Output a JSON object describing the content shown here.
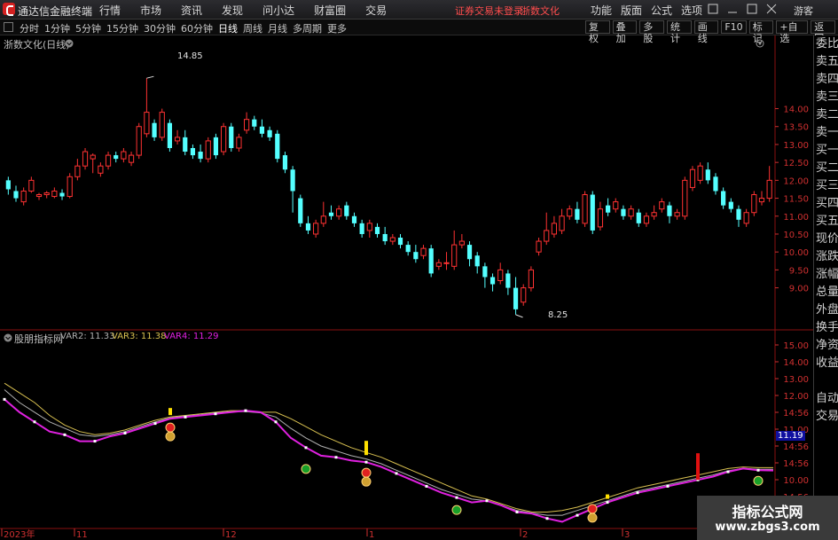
{
  "menubar": {
    "app_name": "通达信金融终端",
    "items": [
      "行情",
      "市场",
      "资讯",
      "发现",
      "问小达",
      "财富圈",
      "交易"
    ],
    "login_status": "证券交易未登录",
    "stock_name": "浙数文化",
    "right_items": [
      "功能",
      "版面",
      "公式",
      "选项"
    ],
    "guest": "游客"
  },
  "toolbar": {
    "periods": [
      "分时",
      "1分钟",
      "5分钟",
      "15分钟",
      "30分钟",
      "60分钟",
      "日线",
      "周线",
      "月线",
      "多周期",
      "更多"
    ],
    "active_period": "日线",
    "tools": [
      "复权",
      "叠加",
      "多股",
      "统计",
      "画线",
      "F10",
      "标记",
      "+自选",
      "返回"
    ]
  },
  "main_chart": {
    "title": "浙数文化(日线)",
    "high_label": "14.85",
    "low_label": "8.25",
    "price_ticks": [
      "14.00",
      "13.50",
      "13.00",
      "12.50",
      "12.00",
      "11.50",
      "11.00",
      "10.50",
      "10.00",
      "9.50",
      "9.00"
    ]
  },
  "indicator": {
    "title": "股朋指标网",
    "var2_label": "VAR2: 11.33",
    "var3_label": "VAR3: 11.38",
    "var4_label": "VAR4: 11.29",
    "current_value": "11.19",
    "ticks": [
      "15.00",
      "14.50",
      "13.00",
      "12.00",
      "11.50",
      "11.00",
      "10.50",
      "10.00"
    ],
    "right_ticks": [
      "15.00",
      "14.00",
      "13.00",
      "12.00",
      "14:56",
      "11.00",
      "14:56",
      "14:56",
      "10.00",
      "14:56"
    ]
  },
  "date_axis": {
    "labels": [
      "2023年",
      "11",
      "12",
      "1",
      "2",
      "3"
    ]
  },
  "right_panel": {
    "items": [
      "委比",
      "卖五",
      "卖四",
      "卖三",
      "卖二",
      "卖一",
      "买一",
      "买二",
      "买三",
      "买四",
      "买五",
      "现价",
      "涨跌",
      "涨幅",
      "总量",
      "外盘",
      "换手",
      "净资",
      "收益",
      "",
      "自动",
      "交易"
    ]
  },
  "watermark": {
    "line1": "指标公式网",
    "line2": "www.zbgs3.com"
  },
  "colors": {
    "up": "#ff3232",
    "down": "#54ffff",
    "var4": "#e020e0",
    "var3": "#d8c050",
    "var2": "#b0b0b0",
    "axis": "#d03030"
  },
  "chart_data": {
    "type": "candlestick",
    "y_range": [
      8.0,
      15.3
    ],
    "candles": [
      [
        12.0,
        11.75,
        12.1,
        11.6
      ],
      [
        11.7,
        11.5,
        11.85,
        11.4
      ],
      [
        11.4,
        11.7,
        11.8,
        11.3
      ],
      [
        11.7,
        12.0,
        12.1,
        11.65
      ],
      [
        11.55,
        11.6,
        11.65,
        11.45
      ],
      [
        11.6,
        11.65,
        11.7,
        11.5
      ],
      [
        11.55,
        11.7,
        11.8,
        11.5
      ],
      [
        11.65,
        11.55,
        11.75,
        11.45
      ],
      [
        11.55,
        12.1,
        12.2,
        11.5
      ],
      [
        12.1,
        12.4,
        12.6,
        12.0
      ],
      [
        12.4,
        12.8,
        12.9,
        12.3
      ],
      [
        12.6,
        12.7,
        12.75,
        12.2
      ],
      [
        12.2,
        12.4,
        12.5,
        12.1
      ],
      [
        12.4,
        12.7,
        12.8,
        12.3
      ],
      [
        12.7,
        12.6,
        12.8,
        12.5
      ],
      [
        12.6,
        12.8,
        12.9,
        12.5
      ],
      [
        12.5,
        12.7,
        12.8,
        12.4
      ],
      [
        12.7,
        13.5,
        13.6,
        12.6
      ],
      [
        13.3,
        13.9,
        14.85,
        13.2
      ],
      [
        13.6,
        13.2,
        13.7,
        13.1
      ],
      [
        13.2,
        13.9,
        14.0,
        13.1
      ],
      [
        13.6,
        12.9,
        13.7,
        12.8
      ],
      [
        13.1,
        13.2,
        13.4,
        13.0
      ],
      [
        13.2,
        12.8,
        13.4,
        12.7
      ],
      [
        12.9,
        12.7,
        13.0,
        12.6
      ],
      [
        12.8,
        12.6,
        13.0,
        12.5
      ],
      [
        12.6,
        13.1,
        13.2,
        12.5
      ],
      [
        13.2,
        12.7,
        13.3,
        12.6
      ],
      [
        12.8,
        13.5,
        13.6,
        12.7
      ],
      [
        13.5,
        12.9,
        13.6,
        12.8
      ],
      [
        12.9,
        13.2,
        13.3,
        12.8
      ],
      [
        13.4,
        13.7,
        13.9,
        13.3
      ],
      [
        13.7,
        13.5,
        13.8,
        13.4
      ],
      [
        13.5,
        13.3,
        13.7,
        13.2
      ],
      [
        13.4,
        13.2,
        13.5,
        13.1
      ],
      [
        13.3,
        12.6,
        13.4,
        12.5
      ],
      [
        12.7,
        12.3,
        12.8,
        12.2
      ],
      [
        12.3,
        11.7,
        12.4,
        11.1
      ],
      [
        11.5,
        10.8,
        11.6,
        10.7
      ],
      [
        10.8,
        10.6,
        11.0,
        10.5
      ],
      [
        10.5,
        10.8,
        10.9,
        10.4
      ],
      [
        10.8,
        11.0,
        11.4,
        10.7
      ],
      [
        11.1,
        11.0,
        11.3,
        10.9
      ],
      [
        11.0,
        11.2,
        11.3,
        10.9
      ],
      [
        11.3,
        11.0,
        11.4,
        10.9
      ],
      [
        11.0,
        10.8,
        11.1,
        10.7
      ],
      [
        10.8,
        10.5,
        10.9,
        10.4
      ],
      [
        10.6,
        10.8,
        10.9,
        10.4
      ],
      [
        10.7,
        10.5,
        10.8,
        10.4
      ],
      [
        10.5,
        10.3,
        10.7,
        10.2
      ],
      [
        10.3,
        10.4,
        10.5,
        10.2
      ],
      [
        10.4,
        10.2,
        10.5,
        10.1
      ],
      [
        10.2,
        10.0,
        10.3,
        9.9
      ],
      [
        10.0,
        9.8,
        10.2,
        9.7
      ],
      [
        9.9,
        10.1,
        10.2,
        9.8
      ],
      [
        10.1,
        9.4,
        10.2,
        9.3
      ],
      [
        9.6,
        9.7,
        9.8,
        9.5
      ],
      [
        9.7,
        9.7,
        10.0,
        9.5
      ],
      [
        9.6,
        10.2,
        10.6,
        9.5
      ],
      [
        10.2,
        10.3,
        10.5,
        10.1
      ],
      [
        10.2,
        9.8,
        10.3,
        9.6
      ],
      [
        9.9,
        9.6,
        10.0,
        9.4
      ],
      [
        9.6,
        9.3,
        9.7,
        9.0
      ],
      [
        9.3,
        9.1,
        9.4,
        8.9
      ],
      [
        9.2,
        9.5,
        9.7,
        9.1
      ],
      [
        9.4,
        9.0,
        9.5,
        8.8
      ],
      [
        9.0,
        8.4,
        9.3,
        8.25
      ],
      [
        8.6,
        9.0,
        9.1,
        8.5
      ],
      [
        9.0,
        9.5,
        9.6,
        8.9
      ],
      [
        10.0,
        10.3,
        10.4,
        9.9
      ],
      [
        10.3,
        10.6,
        11.1,
        10.2
      ],
      [
        10.5,
        10.8,
        11.0,
        10.4
      ],
      [
        10.6,
        11.0,
        11.2,
        10.5
      ],
      [
        11.0,
        11.2,
        11.3,
        10.9
      ],
      [
        11.2,
        10.9,
        11.4,
        10.8
      ],
      [
        10.8,
        11.6,
        11.7,
        10.7
      ],
      [
        11.6,
        10.6,
        11.7,
        10.5
      ],
      [
        10.7,
        11.2,
        11.4,
        10.6
      ],
      [
        11.3,
        11.1,
        11.5,
        11.0
      ],
      [
        11.2,
        11.4,
        11.5,
        11.1
      ],
      [
        11.2,
        11.0,
        11.3,
        10.9
      ],
      [
        11.0,
        11.2,
        11.3,
        10.9
      ],
      [
        11.1,
        10.8,
        11.2,
        10.7
      ],
      [
        10.8,
        11.0,
        11.1,
        10.7
      ],
      [
        11.0,
        11.1,
        11.3,
        10.9
      ],
      [
        11.2,
        11.4,
        11.5,
        11.1
      ],
      [
        11.3,
        11.0,
        11.4,
        10.8
      ],
      [
        11.0,
        11.1,
        11.2,
        10.9
      ],
      [
        11.0,
        12.0,
        12.1,
        10.9
      ],
      [
        11.8,
        12.3,
        12.4,
        11.7
      ],
      [
        12.0,
        12.4,
        12.5,
        11.9
      ],
      [
        12.3,
        12.0,
        12.5,
        11.9
      ],
      [
        12.1,
        11.7,
        12.2,
        11.6
      ],
      [
        11.7,
        11.3,
        11.8,
        11.2
      ],
      [
        11.4,
        11.2,
        11.5,
        11.1
      ],
      [
        11.2,
        10.9,
        11.3,
        10.7
      ],
      [
        10.8,
        11.1,
        11.2,
        10.7
      ],
      [
        11.1,
        11.6,
        11.7,
        11.0
      ],
      [
        11.4,
        11.5,
        11.7,
        11.3
      ],
      [
        11.5,
        12.0,
        12.4,
        11.4
      ]
    ],
    "var4": [
      13.5,
      13.1,
      12.8,
      12.5,
      12.4,
      12.2,
      12.2,
      12.35,
      12.45,
      12.6,
      12.75,
      12.9,
      12.95,
      13.0,
      13.05,
      13.1,
      13.15,
      13.1,
      12.8,
      12.3,
      12.0,
      11.75,
      11.7,
      11.6,
      11.55,
      11.4,
      11.2,
      11.0,
      10.8,
      10.6,
      10.45,
      10.3,
      10.35,
      10.2,
      10.0,
      9.95,
      9.8,
      9.7,
      9.9,
      10.1,
      10.3,
      10.45,
      10.6,
      10.7,
      10.8,
      10.9,
      11.0,
      11.1,
      11.25,
      11.35,
      11.3,
      11.29
    ],
    "var3": [
      14.0,
      13.7,
      13.4,
      13.0,
      12.7,
      12.5,
      12.4,
      12.45,
      12.55,
      12.7,
      12.85,
      12.95,
      13.0,
      13.05,
      13.1,
      13.15,
      13.15,
      13.1,
      13.1,
      12.9,
      12.65,
      12.4,
      12.2,
      12.0,
      11.85,
      11.7,
      11.5,
      11.3,
      11.1,
      10.9,
      10.7,
      10.5,
      10.4,
      10.25,
      10.1,
      10.0,
      10.0,
      10.05,
      10.15,
      10.3,
      10.45,
      10.6,
      10.75,
      10.85,
      10.95,
      11.05,
      11.15,
      11.25,
      11.35,
      11.4,
      11.38,
      11.38
    ],
    "var2": [
      13.8,
      13.4,
      13.1,
      12.8,
      12.6,
      12.4,
      12.35,
      12.4,
      12.5,
      12.65,
      12.8,
      12.92,
      12.98,
      13.02,
      13.08,
      13.12,
      13.12,
      13.08,
      12.95,
      12.6,
      12.3,
      12.05,
      11.9,
      11.75,
      11.65,
      11.5,
      11.3,
      11.1,
      10.9,
      10.7,
      10.55,
      10.4,
      10.35,
      10.2,
      10.05,
      9.97,
      9.9,
      9.9,
      10.05,
      10.2,
      10.35,
      10.5,
      10.65,
      10.75,
      10.85,
      10.95,
      11.05,
      11.15,
      11.28,
      11.36,
      11.33,
      11.33
    ],
    "indicator_range": [
      9.6,
      15.3
    ]
  }
}
